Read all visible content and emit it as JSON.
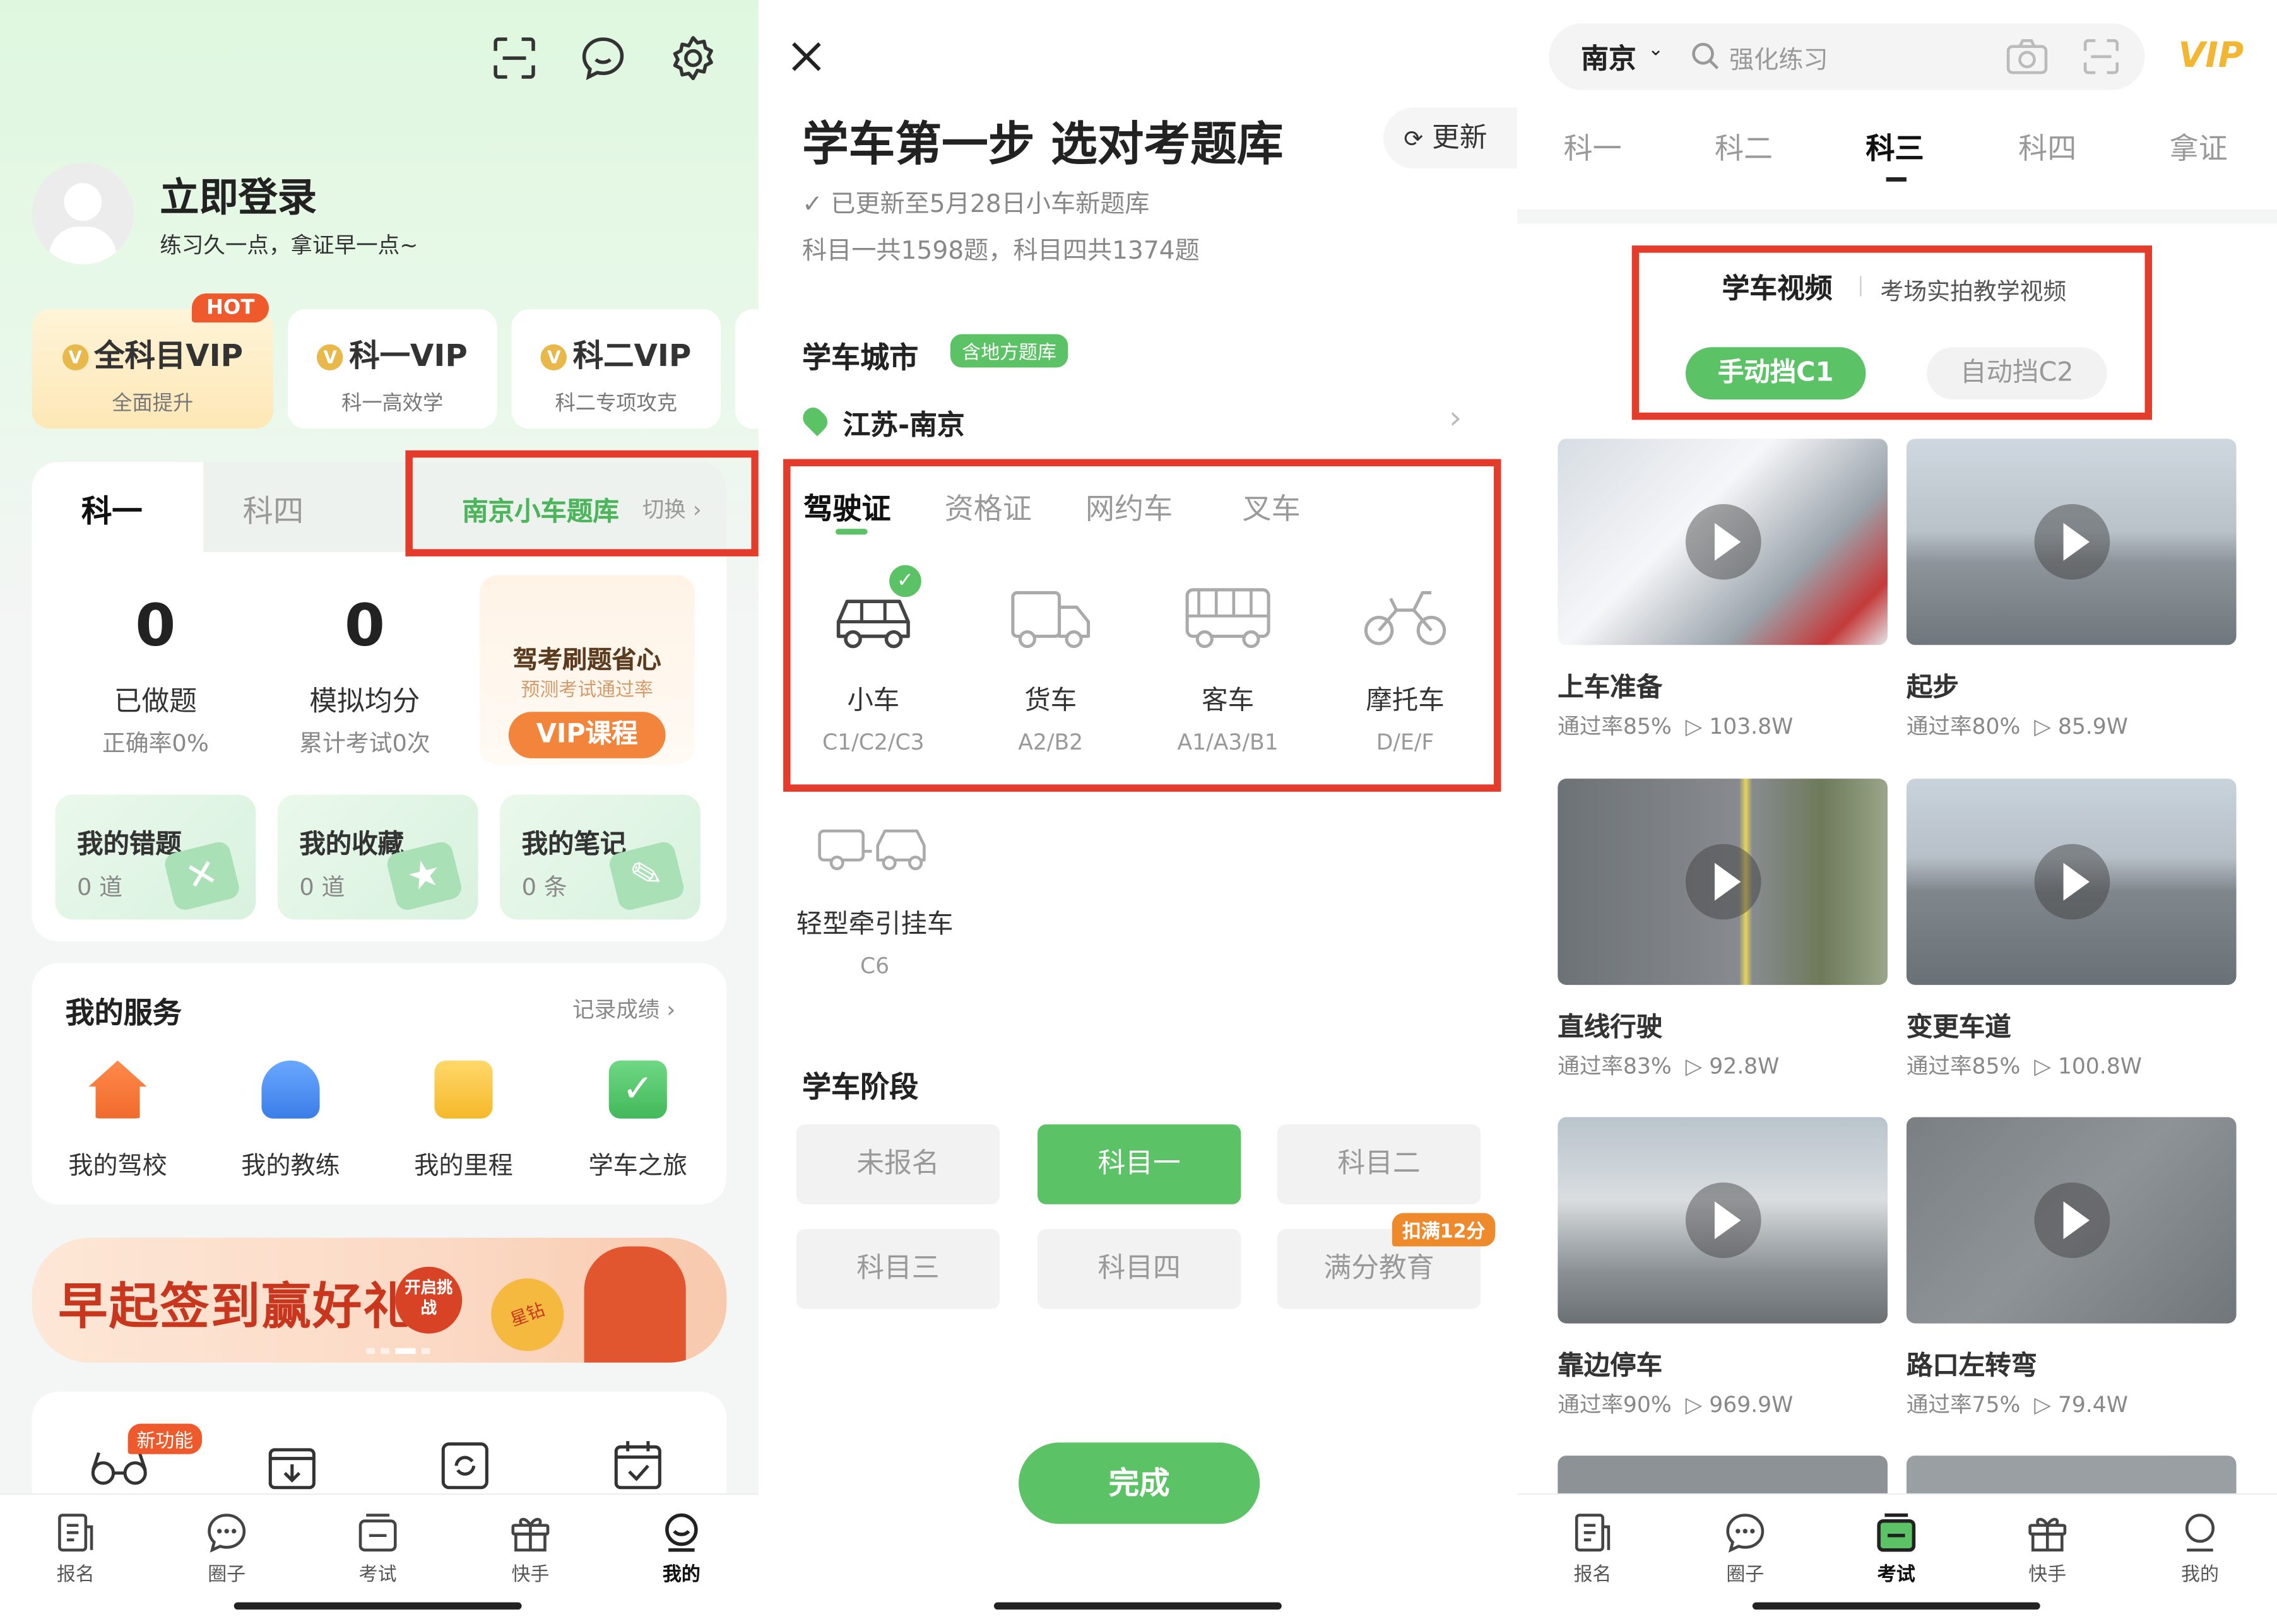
{
  "left": {
    "icons": [
      "scan-icon",
      "chat-icon",
      "settings-icon"
    ],
    "login_title": "立即登录",
    "login_sub": "练习久一点，拿证早一点~",
    "vip_cards": [
      {
        "title": "全科目VIP",
        "sub": "全面提升",
        "badge": "HOT"
      },
      {
        "title": "科一VIP",
        "sub": "科一高效学"
      },
      {
        "title": "科二VIP",
        "sub": "科二专项攻克"
      }
    ],
    "subject_tabs": [
      "科一",
      "科四"
    ],
    "bank": {
      "label": "南京小车题库",
      "switch": "切换"
    },
    "stats": [
      {
        "num": "0",
        "label": "已做题",
        "sub": "正确率0%"
      },
      {
        "num": "0",
        "label": "模拟均分",
        "sub": "累计考试0次"
      }
    ],
    "promo": {
      "title": "驾考刷题省心",
      "sub": "预测考试通过率",
      "button": "VIP课程"
    },
    "mini_cards": [
      {
        "title": "我的错题",
        "count": "0 道"
      },
      {
        "title": "我的收藏",
        "count": "0 道"
      },
      {
        "title": "我的笔记",
        "count": "0 条"
      }
    ],
    "services": {
      "title": "我的服务",
      "link": "记录成绩",
      "items": [
        "我的驾校",
        "我的教练",
        "我的里程",
        "学车之旅"
      ]
    },
    "banner": {
      "text": "早起签到赢好礼",
      "badge": "开启挑战",
      "coin": "星钻"
    },
    "new_badge": "新功能",
    "bottom_nav": [
      "报名",
      "圈子",
      "考试",
      "快手",
      "我的"
    ]
  },
  "middle": {
    "title": "学车第一步 选对考题库",
    "update_btn": "更新",
    "updated": "已更新至5月28日小车新题库",
    "counts": "科目一共1598题，科目四共1374题",
    "city_label": "学车城市",
    "city_tag": "含地方题库",
    "city": "江苏-南京",
    "license_tabs": [
      "驾驶证",
      "资格证",
      "网约车",
      "叉车"
    ],
    "vehicles": [
      {
        "name": "小车",
        "code": "C1/C2/C3"
      },
      {
        "name": "货车",
        "code": "A2/B2"
      },
      {
        "name": "客车",
        "code": "A1/A3/B1"
      },
      {
        "name": "摩托车",
        "code": "D/E/F"
      }
    ],
    "trailer": {
      "name": "轻型牵引挂车",
      "code": "C6"
    },
    "stage_label": "学车阶段",
    "stages": [
      "未报名",
      "科目一",
      "科目二",
      "科目三",
      "科目四",
      "满分教育"
    ],
    "stage_badge": "扣满12分",
    "done": "完成"
  },
  "right": {
    "city": "南京",
    "search_placeholder": "强化练习",
    "vip": "VIP",
    "tabs": [
      "科一",
      "科二",
      "科三",
      "科四",
      "拿证"
    ],
    "video_title": "学车视频",
    "video_sub": "考场实拍教学视频",
    "gear": [
      "手动挡C1",
      "自动挡C2"
    ],
    "videos": [
      {
        "title": "上车准备",
        "rate": "通过率85%",
        "views": "103.8W"
      },
      {
        "title": "起步",
        "rate": "通过率80%",
        "views": "85.9W"
      },
      {
        "title": "直线行驶",
        "rate": "通过率83%",
        "views": "92.8W"
      },
      {
        "title": "变更车道",
        "rate": "通过率85%",
        "views": "100.8W"
      },
      {
        "title": "靠边停车",
        "rate": "通过率90%",
        "views": "969.9W"
      },
      {
        "title": "路口左转弯",
        "rate": "通过率75%",
        "views": "79.4W"
      }
    ],
    "bottom_nav": [
      "报名",
      "圈子",
      "考试",
      "快手",
      "我的"
    ]
  },
  "colors": {
    "accent": "#5cc266",
    "highlight": "#e53b2a",
    "vip_gold": "#e8b84a"
  }
}
